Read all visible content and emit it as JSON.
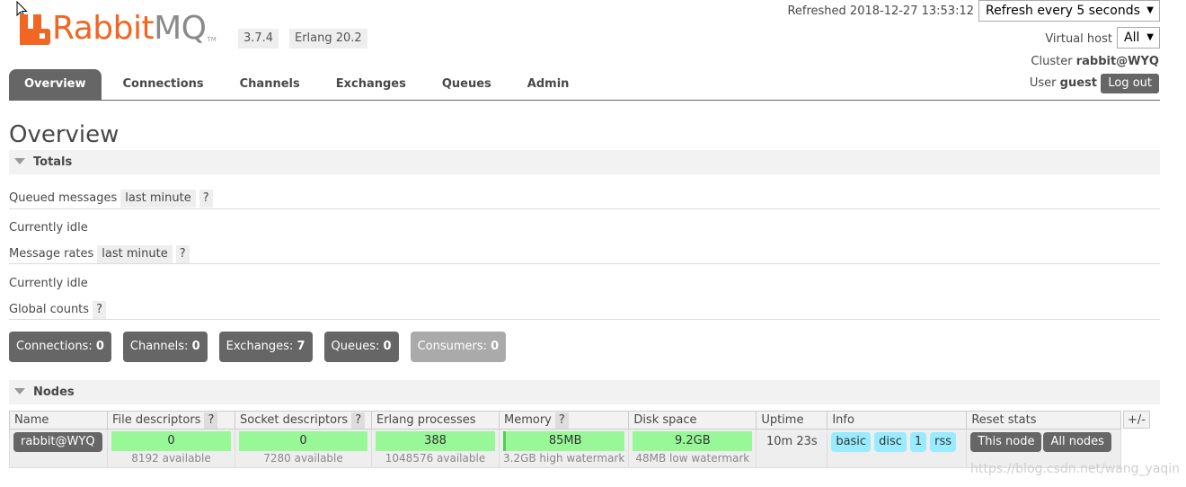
{
  "header": {
    "logo_rabbit": "Rabbit",
    "logo_mq": "MQ",
    "logo_tm": "TM",
    "version": "3.7.4",
    "erlang": "Erlang 20.2",
    "refreshed": "Refreshed 2018-12-27 13:53:12",
    "refresh_select": "Refresh every 5 seconds",
    "vhost_label": "Virtual host",
    "vhost_value": "All",
    "cluster_label": "Cluster",
    "cluster_value": "rabbit@WYQ",
    "user_label": "User",
    "user_value": "guest",
    "logout": "Log out"
  },
  "tabs": [
    {
      "label": "Overview"
    },
    {
      "label": "Connections"
    },
    {
      "label": "Channels"
    },
    {
      "label": "Exchanges"
    },
    {
      "label": "Queues"
    },
    {
      "label": "Admin"
    }
  ],
  "page_title": "Overview",
  "totals": {
    "header": "Totals",
    "queued_label": "Queued messages",
    "queued_range": "last minute",
    "help": "?",
    "idle1": "Currently idle",
    "rates_label": "Message rates",
    "rates_range": "last minute",
    "idle2": "Currently idle",
    "global_label": "Global counts"
  },
  "counts": [
    {
      "label": "Connections:",
      "value": "0"
    },
    {
      "label": "Channels:",
      "value": "0"
    },
    {
      "label": "Exchanges:",
      "value": "7"
    },
    {
      "label": "Queues:",
      "value": "0"
    },
    {
      "label": "Consumers:",
      "value": "0"
    }
  ],
  "nodes": {
    "header": "Nodes",
    "columns": [
      "Name",
      "File descriptors",
      "Socket descriptors",
      "Erlang processes",
      "Memory",
      "Disk space",
      "Uptime",
      "Info",
      "Reset stats"
    ],
    "plusminus": "+/-",
    "row": {
      "name": "rabbit@WYQ",
      "fd": "0",
      "fd_sub": "8192 available",
      "sd": "0",
      "sd_sub": "7280 available",
      "ep": "388",
      "ep_sub": "1048576 available",
      "mem": "85MB",
      "mem_sub": "3.2GB high watermark",
      "disk": "9.2GB",
      "disk_sub": "48MB low watermark",
      "uptime": "10m 23s",
      "info": [
        "basic",
        "disc",
        "1",
        "rss"
      ],
      "reset_this": "This node",
      "reset_all": "All nodes"
    }
  },
  "watermark": "https://blog.csdn.net/wang_yaqin",
  "colors": {
    "brand_orange": "#f26522",
    "dark_gray": "#666666",
    "bar_green": "#98f898",
    "pill_blue": "#99ebff"
  }
}
